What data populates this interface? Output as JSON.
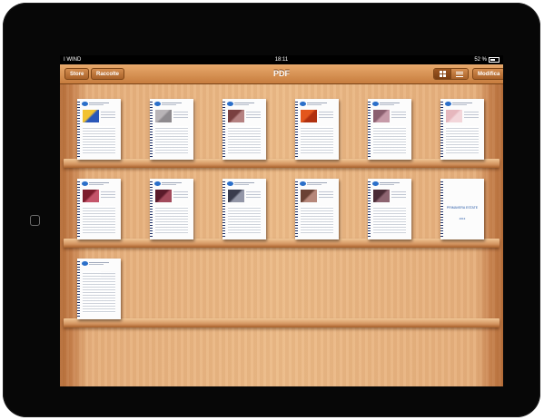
{
  "status": {
    "carrier": "I WIND",
    "time": "18:11",
    "battery": "52 %"
  },
  "navbar": {
    "title": "PDF",
    "store_label": "Store",
    "raccolte_label": "Raccolte",
    "modifica_label": "Modifica",
    "view_mode": "grid"
  },
  "colors": {
    "navbar": "#d48d4f",
    "wood": "#e6b07d",
    "cover_text": "#2457a6"
  },
  "shelves": [
    {
      "books": [
        {
          "swatch": [
            "#f2c230",
            "#2a57b8"
          ]
        },
        {
          "swatch": [
            "#b9b4b7",
            "#8e8a8e"
          ]
        },
        {
          "swatch": [
            "#7a3f3f",
            "#b58181"
          ]
        },
        {
          "swatch": [
            "#e3561c",
            "#b0300f"
          ]
        },
        {
          "swatch": [
            "#8b5f6f",
            "#c69aa8"
          ]
        },
        {
          "swatch": [
            "#e6b7bd",
            "#f3d6da"
          ]
        }
      ]
    },
    {
      "books": [
        {
          "swatch": [
            "#7d1c2c",
            "#c4556a"
          ]
        },
        {
          "swatch": [
            "#5a1a2a",
            "#a24a5c"
          ]
        },
        {
          "swatch": [
            "#3a3c4d",
            "#9396a7"
          ]
        },
        {
          "swatch": [
            "#6a4134",
            "#b6877a"
          ]
        },
        {
          "swatch": [
            "#4a2b35",
            "#8d6470"
          ]
        },
        {
          "cover": true,
          "lines": [
            "PRIMAVERA",
            "ESTATE"
          ],
          "date": "2013"
        }
      ]
    },
    {
      "books": [
        {
          "doc": true
        }
      ]
    }
  ]
}
